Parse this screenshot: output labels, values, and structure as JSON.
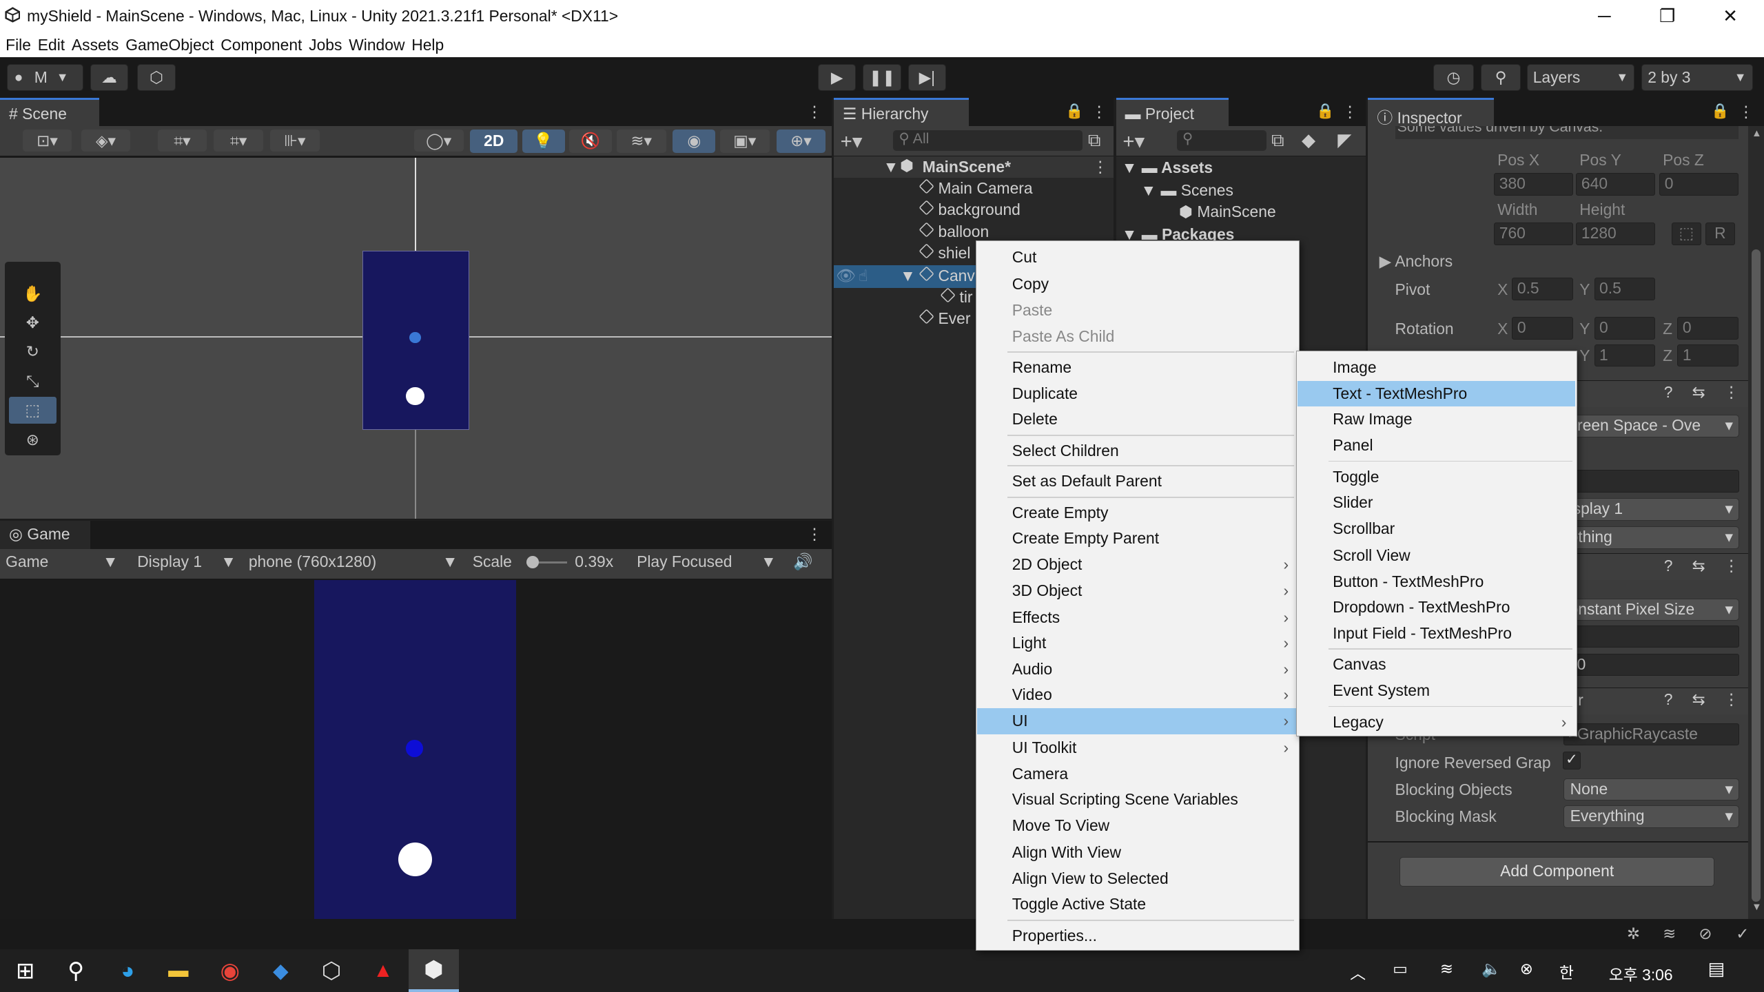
{
  "window": {
    "title": "myShield - MainScene - Windows, Mac, Linux - Unity 2021.3.21f1 Personal* <DX11>",
    "min": "─",
    "max": "❐",
    "close": "✕"
  },
  "menubar": [
    "File",
    "Edit",
    "Assets",
    "GameObject",
    "Component",
    "Jobs",
    "Window",
    "Help"
  ],
  "toolbar": {
    "account": "M",
    "layers": "Layers",
    "layout": "2 by 3"
  },
  "scene": {
    "tab": "Scene",
    "mode2d": "2D"
  },
  "game": {
    "tab": "Game",
    "view": "Game",
    "display": "Display 1",
    "resolution": "phone (760x1280)",
    "scale_label": "Scale",
    "scale_value": "0.39x",
    "play_mode": "Play Focused"
  },
  "hierarchy": {
    "tab": "Hierarchy",
    "search_placeholder": "All",
    "scene": "MainScene*",
    "items": [
      "Main Camera",
      "background",
      "balloon",
      "shiel",
      "Canv",
      "tir",
      "Ever"
    ]
  },
  "project": {
    "tab": "Project",
    "tree": [
      "Assets",
      "Scenes",
      "MainScene",
      "Packages"
    ]
  },
  "context_menu": {
    "items": [
      "Cut",
      "Copy",
      "Paste",
      "Paste As Child",
      "Rename",
      "Duplicate",
      "Delete",
      "Select Children",
      "Set as Default Parent",
      "Create Empty",
      "Create Empty Parent",
      "2D Object",
      "3D Object",
      "Effects",
      "Light",
      "Audio",
      "Video",
      "UI",
      "UI Toolkit",
      "Camera",
      "Visual Scripting Scene Variables",
      "Move To View",
      "Align With View",
      "Align View to Selected",
      "Toggle Active State",
      "Properties..."
    ]
  },
  "submenu": {
    "items": [
      "Image",
      "Text - TextMeshPro",
      "Raw Image",
      "Panel",
      "Toggle",
      "Slider",
      "Scrollbar",
      "Scroll View",
      "Button - TextMeshPro",
      "Dropdown - TextMeshPro",
      "Input Field - TextMeshPro",
      "Canvas",
      "Event System",
      "Legacy"
    ]
  },
  "inspector": {
    "tab": "Inspector",
    "note": "Some values driven by Canvas.",
    "posx_l": "Pos X",
    "posy_l": "Pos Y",
    "posz_l": "Pos Z",
    "posx": "380",
    "posy": "640",
    "posz": "0",
    "width_l": "Width",
    "height_l": "Height",
    "width": "760",
    "height": "1280",
    "r": "R",
    "anchors": "Anchors",
    "pivot": "Pivot",
    "pivot_x": "0.5",
    "pivot_y": "0.5",
    "rotation": "Rotation",
    "rot_x": "0",
    "rot_y": "0",
    "rot_z": "0",
    "scale_y": "1",
    "scale_z": "1",
    "x": "X",
    "y": "Y",
    "z": "Z",
    "render_mode": "creen Space - Ove",
    "target_display": "isplay 1",
    "additional": "othing",
    "scale_mode": "onstant Pixel Size",
    "ref_ppu": "00",
    "raycaster_tail": "ter",
    "script_l": "Script",
    "script": "GraphicRaycaste",
    "ignore_l": "Ignore Reversed Grap",
    "blocking_obj_l": "Blocking Objects",
    "blocking_obj": "None",
    "blocking_mask_l": "Blocking Mask",
    "blocking_mask": "Everything",
    "add_component": "Add Component"
  },
  "taskbar": {
    "time": "오후 3:06"
  },
  "colors": {
    "selection": "#99c9ef",
    "canvas_blue": "#17175e",
    "scene_bg": "#484848"
  }
}
